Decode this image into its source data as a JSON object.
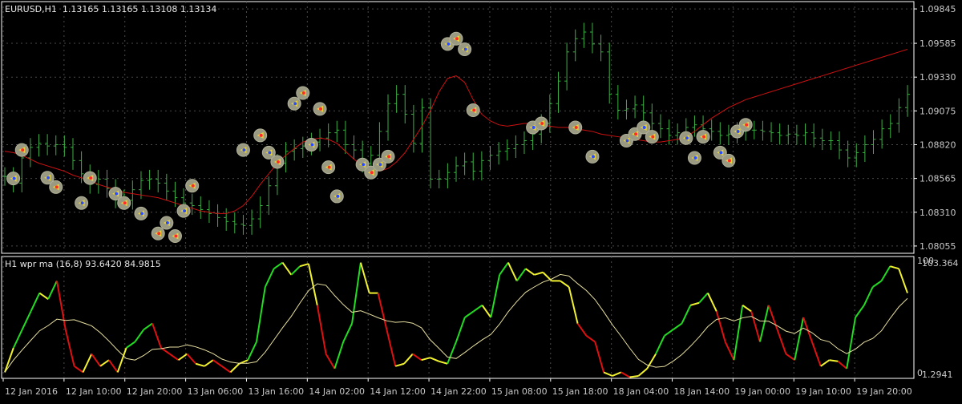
{
  "chart_header": {
    "symbol_tf": "EURUSD,H1",
    "open": "1.13165",
    "high": "1.13165",
    "low": "1.13108",
    "close": "1.13134"
  },
  "indicator_header": {
    "name": "H1 wpr ma (16,8)",
    "value1": "93.6420",
    "value2": "84.9815"
  },
  "price_axis": [
    "1.09845",
    "1.09585",
    "1.09330",
    "1.09075",
    "1.08820",
    "1.08565",
    "1.08310",
    "1.08055"
  ],
  "indicator_axis": {
    "top": "100",
    "top_value": "103.364",
    "bottom": "0",
    "bottom_value": "1.2941"
  },
  "time_axis": [
    "12 Jan 2016",
    "12 Jan 10:00",
    "12 Jan 20:00",
    "13 Jan 06:00",
    "13 Jan 16:00",
    "14 Jan 02:00",
    "14 Jan 12:00",
    "14 Jan 22:00",
    "15 Jan 08:00",
    "15 Jan 18:00",
    "18 Jan 04:00",
    "18 Jan 14:00",
    "19 Jan 00:00",
    "19 Jan 10:00",
    "19 Jan 20:00"
  ],
  "colors": {
    "background": "#000000",
    "grid": "#4a4a4a",
    "bar": "#3cb043",
    "moving_average": "#cc1111",
    "wpr_up": "#22dd22",
    "wpr_flat": "#f2f230",
    "wpr_down": "#e01010",
    "signal_line": "#e8e0a0",
    "signal_marker": "#9a9a82"
  },
  "chart_data": {
    "type": "line",
    "price_bars": [
      1.0858,
      1.0853,
      1.0872,
      1.088,
      1.0883,
      1.0881,
      1.0882,
      1.088,
      1.087,
      1.086,
      1.0852,
      1.0856,
      1.0849,
      1.0841,
      1.084,
      1.0848,
      1.0855,
      1.0856,
      1.0853,
      1.0847,
      1.0842,
      1.0838,
      1.0836,
      1.0833,
      1.083,
      1.0827,
      1.0824,
      1.0822,
      1.0821,
      1.0826,
      1.0836,
      1.0851,
      1.0868,
      1.0877,
      1.0879,
      1.0881,
      1.0884,
      1.0887,
      1.0891,
      1.0893,
      1.0882,
      1.0878,
      1.0868,
      1.0874,
      1.0892,
      1.0913,
      1.092,
      1.0905,
      1.0883,
      1.091,
      1.0856,
      1.0856,
      1.0861,
      1.0866,
      1.0869,
      1.0862,
      1.087,
      1.0874,
      1.0877,
      1.0879,
      1.0882,
      1.0885,
      1.089,
      1.0898,
      1.0913,
      1.093,
      1.0952,
      1.0962,
      1.0967,
      1.0958,
      1.0952,
      1.092,
      1.0908,
      1.0909,
      1.0912,
      1.0906,
      1.0898,
      1.0894,
      1.0889,
      1.0891,
      1.0895,
      1.0897,
      1.0894,
      1.0892,
      1.0889,
      1.089,
      1.0892,
      1.0893,
      1.0893,
      1.0892,
      1.0891,
      1.0889,
      1.089,
      1.0889,
      1.0891,
      1.0887,
      1.0885,
      1.0885,
      1.0878,
      1.0872,
      1.0876,
      1.0882,
      1.0886,
      1.0894,
      1.0898,
      1.091,
      1.092
    ],
    "moving_average": [
      1.0877,
      1.0876,
      1.0874,
      1.0871,
      1.0868,
      1.0866,
      1.0864,
      1.0862,
      1.0859,
      1.0857,
      1.0855,
      1.0852,
      1.085,
      1.0848,
      1.0846,
      1.0845,
      1.0844,
      1.0843,
      1.0842,
      1.084,
      1.0838,
      1.0836,
      1.0834,
      1.0832,
      1.0831,
      1.083,
      1.083,
      1.0832,
      1.0836,
      1.0843,
      1.0852,
      1.086,
      1.0868,
      1.0874,
      1.0879,
      1.0884,
      1.0886,
      1.0887,
      1.0886,
      1.0883,
      1.0877,
      1.0871,
      1.0866,
      1.0863,
      1.0862,
      1.0864,
      1.0869,
      1.0876,
      1.0886,
      1.0896,
      1.0908,
      1.0922,
      1.0932,
      1.0934,
      1.0929,
      1.0916,
      1.0905,
      1.09,
      1.0897,
      1.0896,
      1.0897,
      1.0898,
      1.0898,
      1.0897,
      1.0896,
      1.0895,
      1.0895,
      1.0894,
      1.0893,
      1.0892,
      1.089,
      1.0889,
      1.0888,
      1.0887,
      1.0886,
      1.0885,
      1.0884,
      1.0884,
      1.0885,
      1.0886,
      1.0888,
      1.0892,
      1.0897,
      1.0902,
      1.0906,
      1.091,
      1.0913,
      1.0916,
      1.0918,
      1.092,
      1.0922,
      1.0924,
      1.0926,
      1.0928,
      1.093,
      1.0932,
      1.0934,
      1.0936,
      1.0938,
      1.094,
      1.0942,
      1.0944,
      1.0946,
      1.0948,
      1.095,
      1.0952,
      1.0954
    ],
    "signal_markers": [
      {
        "i": 1,
        "price": 1.08565,
        "kind": "up"
      },
      {
        "i": 2,
        "price": 1.0878,
        "kind": "dn"
      },
      {
        "i": 5,
        "price": 1.0857,
        "kind": "up"
      },
      {
        "i": 6,
        "price": 1.085,
        "kind": "dn"
      },
      {
        "i": 9,
        "price": 1.0838,
        "kind": "up"
      },
      {
        "i": 10,
        "price": 1.08568,
        "kind": "dn"
      },
      {
        "i": 13,
        "price": 1.0845,
        "kind": "up"
      },
      {
        "i": 14,
        "price": 1.0838,
        "kind": "dn"
      },
      {
        "i": 16,
        "price": 1.083,
        "kind": "up"
      },
      {
        "i": 18,
        "price": 1.0815,
        "kind": "dn"
      },
      {
        "i": 19,
        "price": 1.0823,
        "kind": "up"
      },
      {
        "i": 20,
        "price": 1.0813,
        "kind": "dn"
      },
      {
        "i": 21,
        "price": 1.0832,
        "kind": "up"
      },
      {
        "i": 22,
        "price": 1.0851,
        "kind": "dn"
      },
      {
        "i": 28,
        "price": 1.0878,
        "kind": "up"
      },
      {
        "i": 30,
        "price": 1.0889,
        "kind": "dn"
      },
      {
        "i": 31,
        "price": 1.0876,
        "kind": "up"
      },
      {
        "i": 32,
        "price": 1.0869,
        "kind": "dn"
      },
      {
        "i": 34,
        "price": 1.0913,
        "kind": "up"
      },
      {
        "i": 35,
        "price": 1.0921,
        "kind": "dn"
      },
      {
        "i": 36,
        "price": 1.0882,
        "kind": "up"
      },
      {
        "i": 37,
        "price": 1.0909,
        "kind": "dn"
      },
      {
        "i": 38,
        "price": 1.0865,
        "kind": "dn"
      },
      {
        "i": 39,
        "price": 1.0843,
        "kind": "up"
      },
      {
        "i": 42,
        "price": 1.0867,
        "kind": "up"
      },
      {
        "i": 43,
        "price": 1.0861,
        "kind": "dn"
      },
      {
        "i": 44,
        "price": 1.0867,
        "kind": "up"
      },
      {
        "i": 45,
        "price": 1.0873,
        "kind": "dn"
      },
      {
        "i": 52,
        "price": 1.0958,
        "kind": "up"
      },
      {
        "i": 53,
        "price": 1.0962,
        "kind": "dn"
      },
      {
        "i": 54,
        "price": 1.0954,
        "kind": "up"
      },
      {
        "i": 55,
        "price": 1.0908,
        "kind": "dn"
      },
      {
        "i": 62,
        "price": 1.0895,
        "kind": "up"
      },
      {
        "i": 63,
        "price": 1.0898,
        "kind": "dn"
      },
      {
        "i": 67,
        "price": 1.0895,
        "kind": "dn"
      },
      {
        "i": 69,
        "price": 1.0873,
        "kind": "up"
      },
      {
        "i": 73,
        "price": 1.0885,
        "kind": "up"
      },
      {
        "i": 74,
        "price": 1.089,
        "kind": "dn"
      },
      {
        "i": 75,
        "price": 1.0895,
        "kind": "up"
      },
      {
        "i": 76,
        "price": 1.0888,
        "kind": "dn"
      },
      {
        "i": 80,
        "price": 1.0887,
        "kind": "up"
      },
      {
        "i": 81,
        "price": 1.0872,
        "kind": "up"
      },
      {
        "i": 82,
        "price": 1.0888,
        "kind": "dn"
      },
      {
        "i": 84,
        "price": 1.0876,
        "kind": "up"
      },
      {
        "i": 85,
        "price": 1.087,
        "kind": "dn"
      },
      {
        "i": 86,
        "price": 1.0892,
        "kind": "up"
      },
      {
        "i": 87,
        "price": 1.0897,
        "kind": "dn"
      }
    ],
    "wpr": [
      5,
      25,
      40,
      55,
      70,
      65,
      80,
      40,
      10,
      5,
      20,
      10,
      15,
      5,
      25,
      30,
      40,
      45,
      25,
      20,
      15,
      20,
      12,
      10,
      15,
      10,
      5,
      12,
      15,
      30,
      75,
      90,
      95,
      85,
      92,
      94,
      60,
      20,
      8,
      30,
      45,
      95,
      70,
      70,
      40,
      10,
      12,
      20,
      15,
      17,
      14,
      12,
      30,
      50,
      55,
      60,
      50,
      85,
      95,
      80,
      90,
      85,
      87,
      80,
      80,
      75,
      45,
      35,
      30,
      5,
      2,
      5,
      1,
      2,
      8,
      20,
      35,
      40,
      45,
      60,
      62,
      70,
      55,
      30,
      15,
      60,
      55,
      30,
      60,
      40,
      20,
      15,
      50,
      30,
      10,
      15,
      14,
      8,
      50,
      60,
      75,
      80,
      92,
      90,
      70
    ]
  }
}
